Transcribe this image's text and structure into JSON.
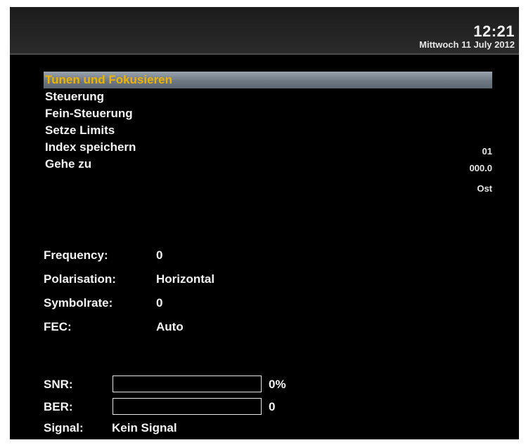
{
  "header": {
    "time": "12:21",
    "date": "Mittwoch 11 July 2012"
  },
  "menu": {
    "items": [
      {
        "label": "Tunen und Fokusieren",
        "selected": true
      },
      {
        "label": "Steuerung",
        "selected": false
      },
      {
        "label": "Fein-Steuerung",
        "selected": false
      },
      {
        "label": "Setze Limits",
        "selected": false
      },
      {
        "label": "Index speichern",
        "selected": false
      },
      {
        "label": "Gehe zu",
        "selected": false
      }
    ],
    "values": {
      "index": "01",
      "position": "000.0",
      "direction": "Ost"
    }
  },
  "transponder": {
    "frequency_label": "Frequency:",
    "frequency_value": "0",
    "polarisation_label": "Polarisation:",
    "polarisation_value": "Horizontal",
    "symbolrate_label": "Symbolrate:",
    "symbolrate_value": "0",
    "fec_label": "FEC:",
    "fec_value": "Auto"
  },
  "signal": {
    "snr_label": "SNR:",
    "snr_value": "0%",
    "snr_level": 0,
    "ber_label": "BER:",
    "ber_value": "0",
    "ber_level": 0,
    "signal_label": "Signal:",
    "signal_value": "Kein Signal"
  },
  "colors": {
    "background": "#000000",
    "text": "#f2f2f2",
    "highlight_text": "#f0b400",
    "highlight_bar": "#7a848e"
  }
}
